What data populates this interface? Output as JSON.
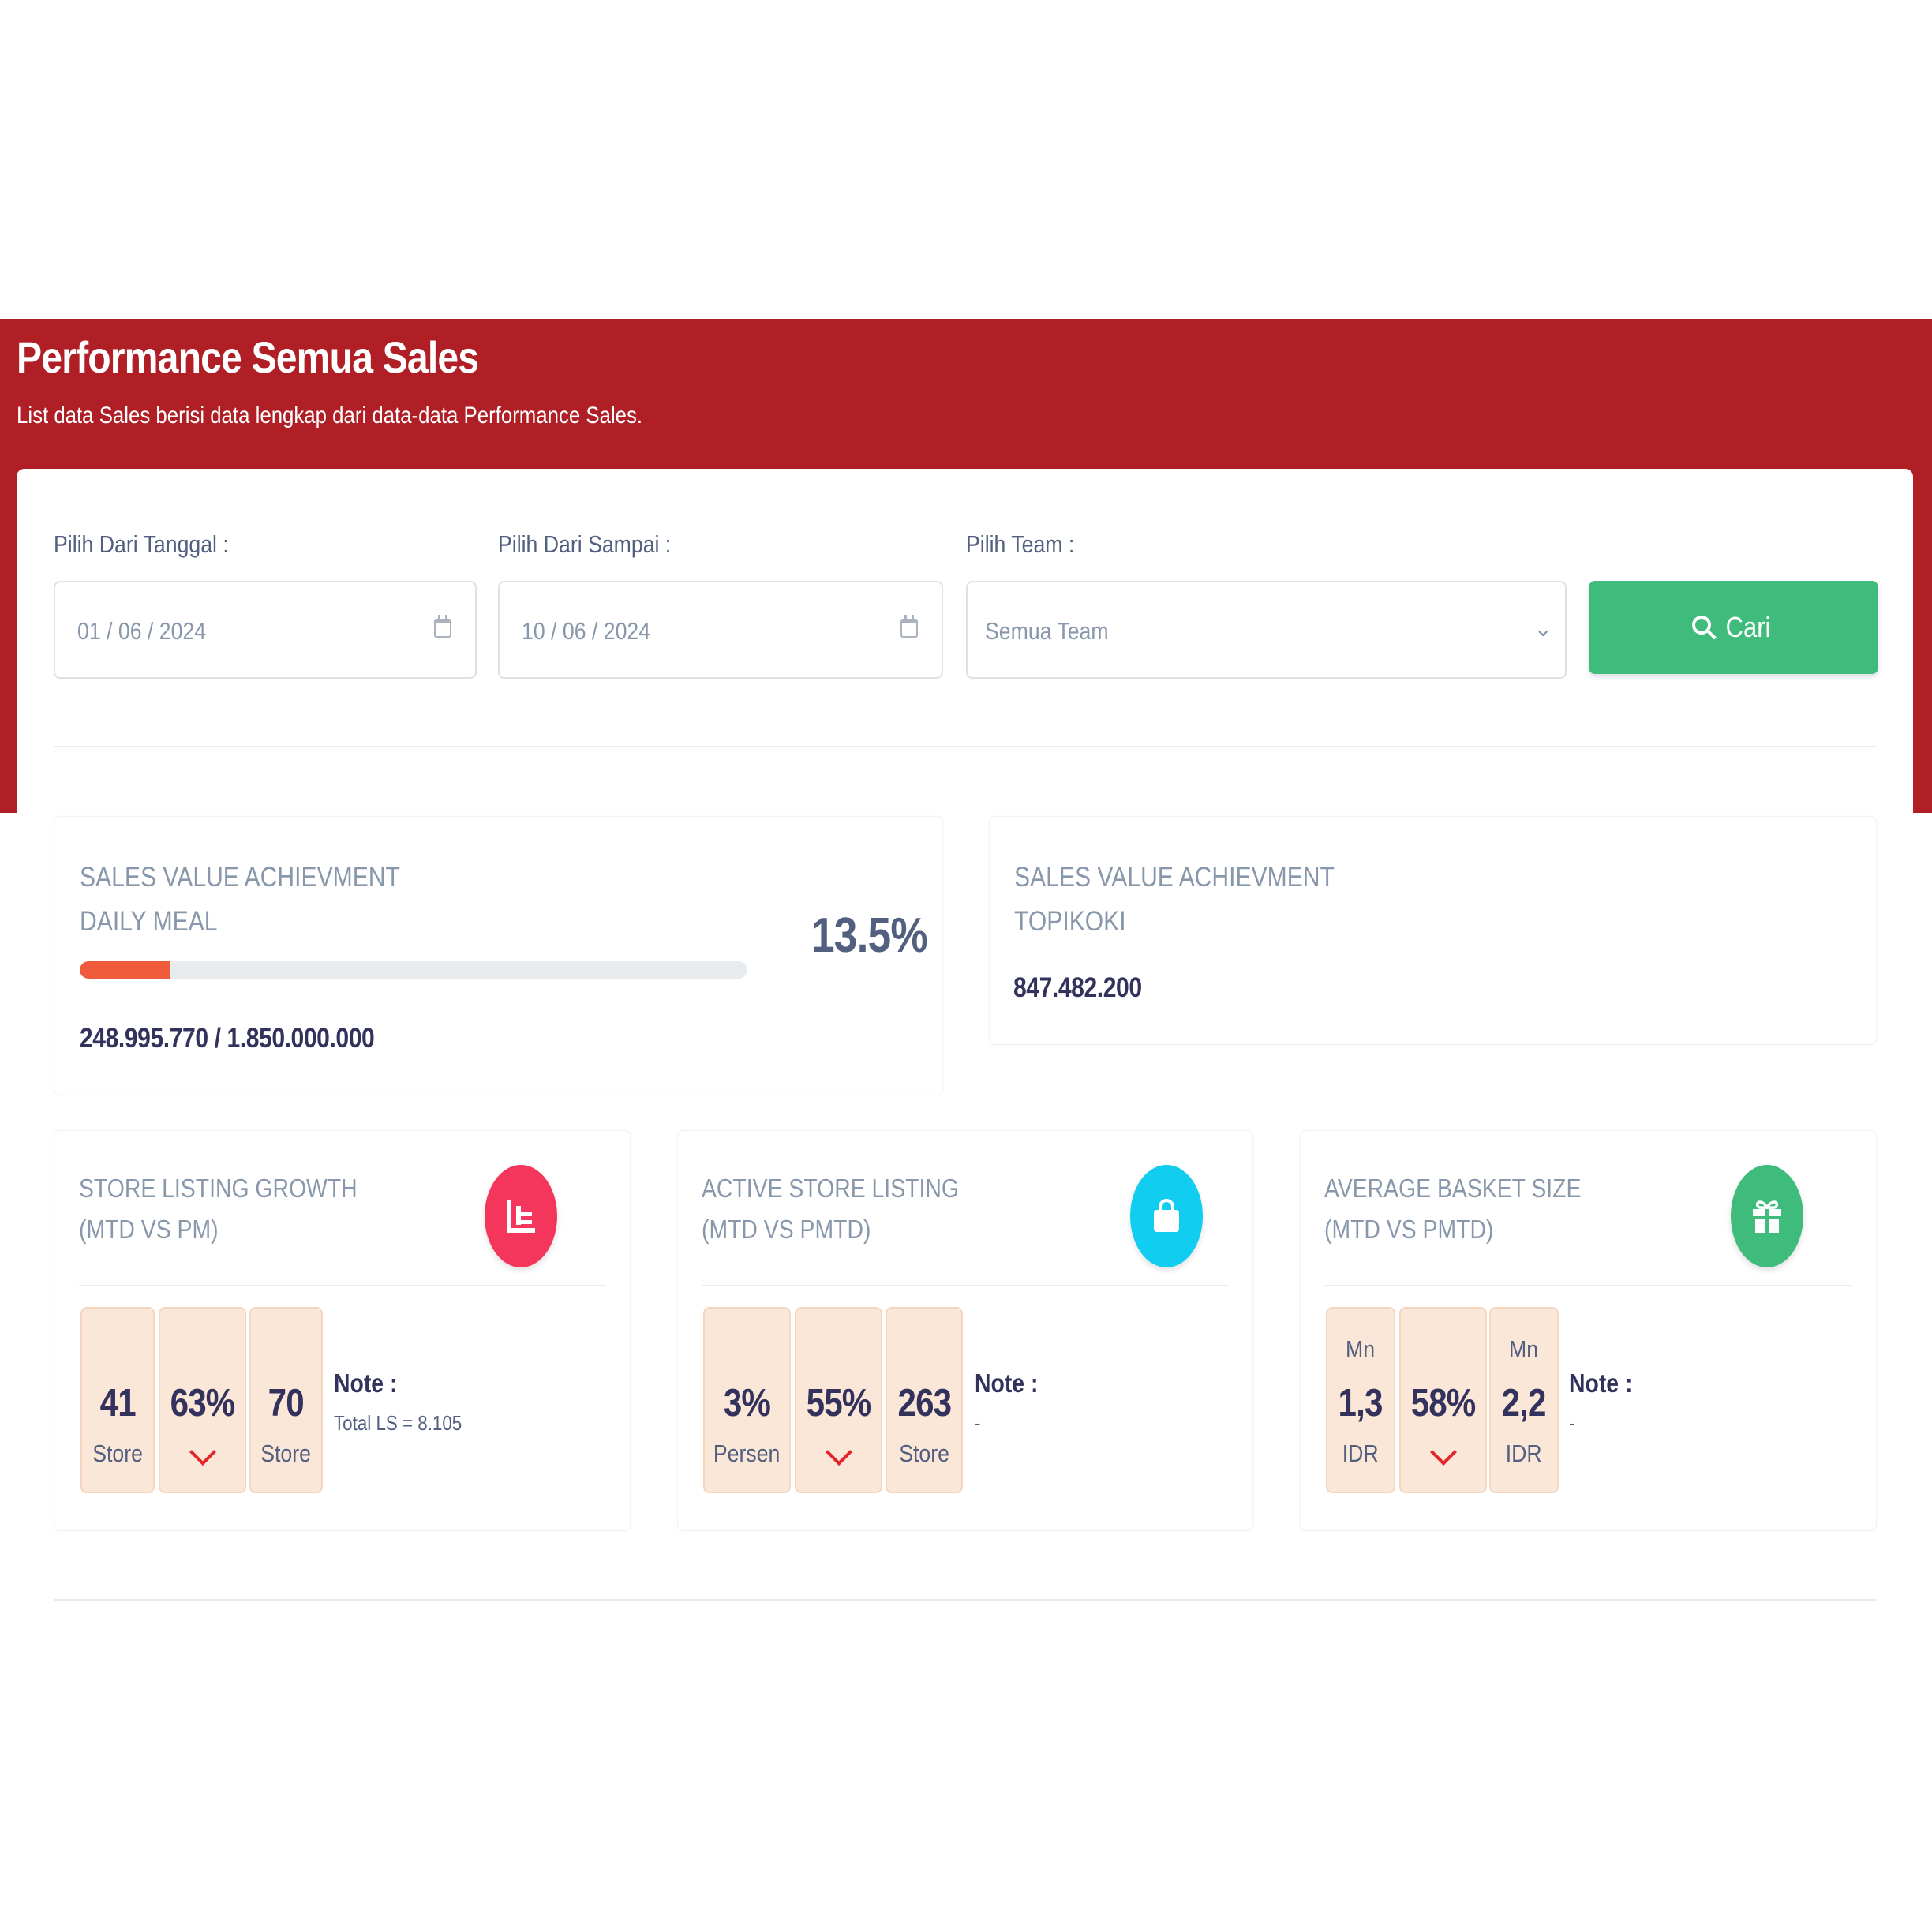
{
  "header": {
    "title": "Performance Semua Sales",
    "subtitle": "List data Sales berisi data lengkap dari data-data Performance Sales."
  },
  "filters": {
    "from_date": {
      "label": "Pilih Dari Tanggal :",
      "value": "01 / 06 / 2024"
    },
    "to_date": {
      "label": "Pilih Dari Sampai :",
      "value": "10 / 06 / 2024"
    },
    "team": {
      "label": "Pilih Team :",
      "value": "Semua Team"
    },
    "search_button": "Cari"
  },
  "achievement_daily_meal": {
    "title_line1": "SALES VALUE ACHIEVMENT",
    "title_line2": "DAILY MEAL",
    "percent": "13.5%",
    "progress_fraction": 0.135,
    "values": "248.995.770 / 1.850.000.000"
  },
  "achievement_topikoki": {
    "title_line1": "SALES VALUE ACHIEVMENT",
    "title_line2": "TOPIKOKI",
    "value": "847.482.200"
  },
  "store_listing_growth": {
    "title_line1": "STORE LISTING GROWTH",
    "title_line2": "(MTD VS PM)",
    "icon": "chart-list-icon",
    "color": "#f5365c",
    "cells": [
      {
        "num": "41",
        "unit": "Store"
      },
      {
        "num": "63%",
        "trend": "down"
      },
      {
        "num": "70",
        "unit": "Store"
      }
    ],
    "note_label": "Note :",
    "note_text": "Total LS = 8.105"
  },
  "active_store_listing": {
    "title_line1": "ACTIVE STORE LISTING",
    "title_line2": "(MTD VS PMTD)",
    "icon": "shopping-bag-icon",
    "color": "#11cdef",
    "cells": [
      {
        "num": "3%",
        "unit": "Persen"
      },
      {
        "num": "55%",
        "trend": "down"
      },
      {
        "num": "263",
        "unit": "Store"
      }
    ],
    "note_label": "Note :",
    "note_text": "-"
  },
  "average_basket_size": {
    "title_line1": "AVERAGE BASKET SIZE",
    "title_line2": "(MTD VS PMTD)",
    "icon": "gift-icon",
    "color": "#3fbb7b",
    "cells": [
      {
        "top": "Mn",
        "num": "1,3",
        "unit": "IDR"
      },
      {
        "num": "58%",
        "trend": "down"
      },
      {
        "top": "Mn",
        "num": "2,2",
        "unit": "IDR"
      }
    ],
    "note_label": "Note :",
    "note_text": "-"
  },
  "colors": {
    "header_red": "#b01f26",
    "button_green": "#3fbb7b",
    "progress_orange": "#f05b3c",
    "cell_peach": "#fbe7d8",
    "trend_down_red": "#e3262c"
  }
}
